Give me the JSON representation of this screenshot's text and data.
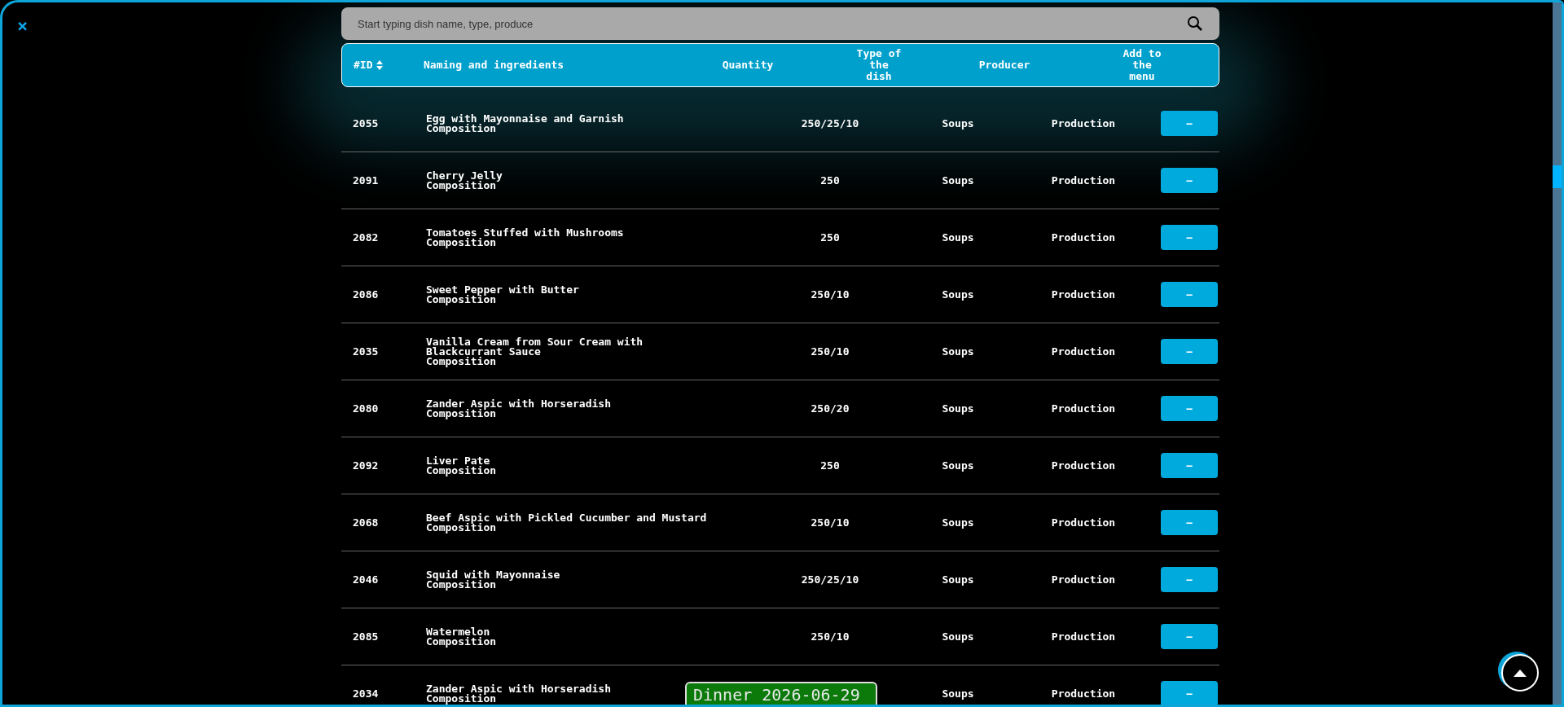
{
  "search": {
    "placeholder": "Start typing dish name, type, produce"
  },
  "columns": [
    {
      "label": "#ID",
      "sortable": true
    },
    {
      "label": "Naming and ingredients"
    },
    {
      "label": "Quantity"
    },
    {
      "label": "Type of the dish"
    },
    {
      "label": "Producer"
    },
    {
      "label": "Add to the menu"
    }
  ],
  "rows": [
    {
      "id": "2055",
      "name": [
        "Egg with Mayonnaise and Garnish"
      ],
      "composition": "Composition",
      "quantity": "250/25/10",
      "type": "Soups",
      "producer": "Production",
      "button": "—"
    },
    {
      "id": "2091",
      "name": [
        "Cherry Jelly"
      ],
      "composition": "Composition",
      "quantity": "250",
      "type": "Soups",
      "producer": "Production",
      "button": "—"
    },
    {
      "id": "2082",
      "name": [
        "Tomatoes Stuffed with Mushrooms"
      ],
      "composition": "Composition",
      "quantity": "250",
      "type": "Soups",
      "producer": "Production",
      "button": "—"
    },
    {
      "id": "2086",
      "name": [
        "Sweet Pepper with Butter"
      ],
      "composition": "Composition",
      "quantity": "250/10",
      "type": "Soups",
      "producer": "Production",
      "button": "—"
    },
    {
      "id": "2035",
      "name": [
        "Vanilla Cream from Sour Cream with",
        "Blackcurrant Sauce"
      ],
      "composition": "Composition",
      "quantity": "250/10",
      "type": "Soups",
      "producer": "Production",
      "button": "—"
    },
    {
      "id": "2080",
      "name": [
        "Zander Aspic with Horseradish"
      ],
      "composition": "Composition",
      "quantity": "250/20",
      "type": "Soups",
      "producer": "Production",
      "button": "—"
    },
    {
      "id": "2092",
      "name": [
        "Liver Pate"
      ],
      "composition": "Composition",
      "quantity": "250",
      "type": "Soups",
      "producer": "Production",
      "button": "—"
    },
    {
      "id": "2068",
      "name": [
        "Beef Aspic with Pickled Cucumber and Mustard"
      ],
      "composition": "Composition",
      "quantity": "250/10",
      "type": "Soups",
      "producer": "Production",
      "button": "—"
    },
    {
      "id": "2046",
      "name": [
        "Squid with Mayonnaise"
      ],
      "composition": "Composition",
      "quantity": "250/25/10",
      "type": "Soups",
      "producer": "Production",
      "button": "—"
    },
    {
      "id": "2085",
      "name": [
        "Watermelon"
      ],
      "composition": "Composition",
      "quantity": "250/10",
      "type": "Soups",
      "producer": "Production",
      "button": "—"
    },
    {
      "id": "2034",
      "name": [
        "Zander Aspic with Horseradish"
      ],
      "composition": "Composition",
      "type": "Soups",
      "producer": "Production",
      "button": "—"
    }
  ],
  "close": "×",
  "meal_badge": "Dinner 2026-06-29"
}
